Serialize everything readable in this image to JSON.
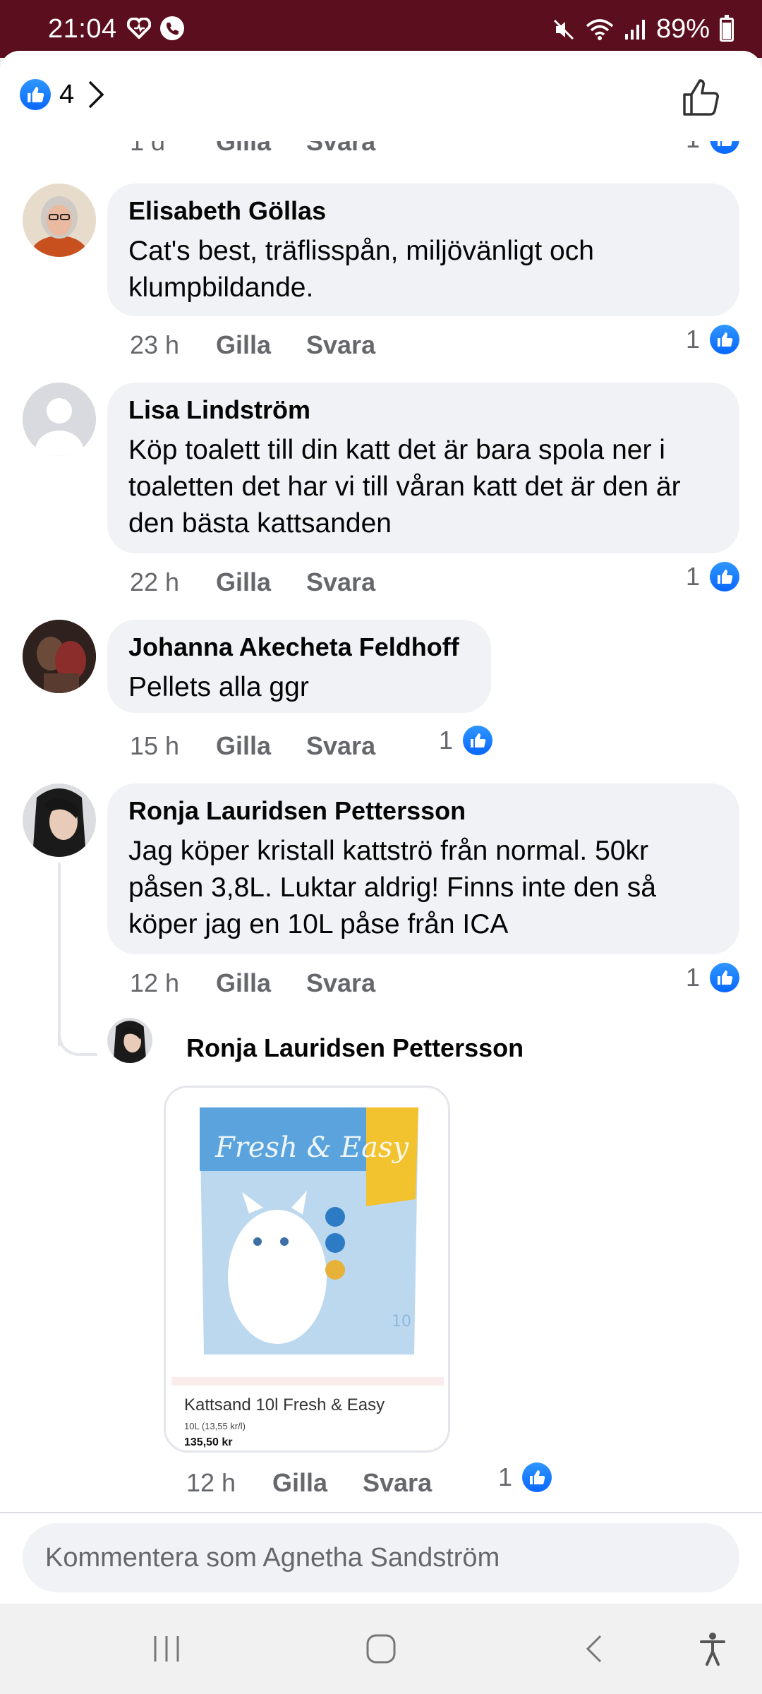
{
  "status_bar": {
    "time": "21:04",
    "battery": "89%",
    "icons": [
      "heart-icon",
      "phone-icon",
      "mute-icon",
      "wifi-icon",
      "signal-icon",
      "battery-icon"
    ]
  },
  "reactions": {
    "count": "4"
  },
  "partial_row": {
    "time": "1 d",
    "like": "Gilla",
    "reply": "Svara",
    "count": "1"
  },
  "comments": [
    {
      "author": "Elisabeth Göllas",
      "text": "Cat's best, träflisspån, miljövänligt och klumpbildande.",
      "time": "23 h",
      "like": "Gilla",
      "reply": "Svara",
      "reactions": "1"
    },
    {
      "author": "Lisa Lindström",
      "text": "Köp toalett till din katt det är bara spola ner i toaletten  det har vi till våran katt   det är den är den bästa kattsanden",
      "time": "22 h",
      "like": "Gilla",
      "reply": "Svara",
      "reactions": "1"
    },
    {
      "author": "Johanna Akecheta Feldhoff",
      "text": "Pellets alla ggr",
      "time": "15 h",
      "like": "Gilla",
      "reply": "Svara",
      "reactions": "1"
    },
    {
      "author": "Ronja Lauridsen Pettersson",
      "text": "Jag köper kristall kattströ från normal. 50kr påsen 3,8L. Luktar aldrig! Finns inte den så köper jag en 10L påse från ICA",
      "time": "12 h",
      "like": "Gilla",
      "reply": "Svara",
      "reactions": "1"
    }
  ],
  "reply": {
    "author": "Ronja Lauridsen Pettersson",
    "attachment": {
      "title": "Kattsand 10l Fresh & Easy",
      "subtitle": "10L (13,55 kr/l)",
      "price": "135,50 kr",
      "package_brand": "Fresh & Easy",
      "package_size": "10"
    },
    "time": "12 h",
    "like": "Gilla",
    "reply": "Svara",
    "reactions": "1"
  },
  "composer": {
    "placeholder": "Kommentera som Agnetha Sandström"
  },
  "colors": {
    "status_bar": "#5b0f1e",
    "like_blue": "#0866ff",
    "bubble": "#f0f2f5"
  }
}
